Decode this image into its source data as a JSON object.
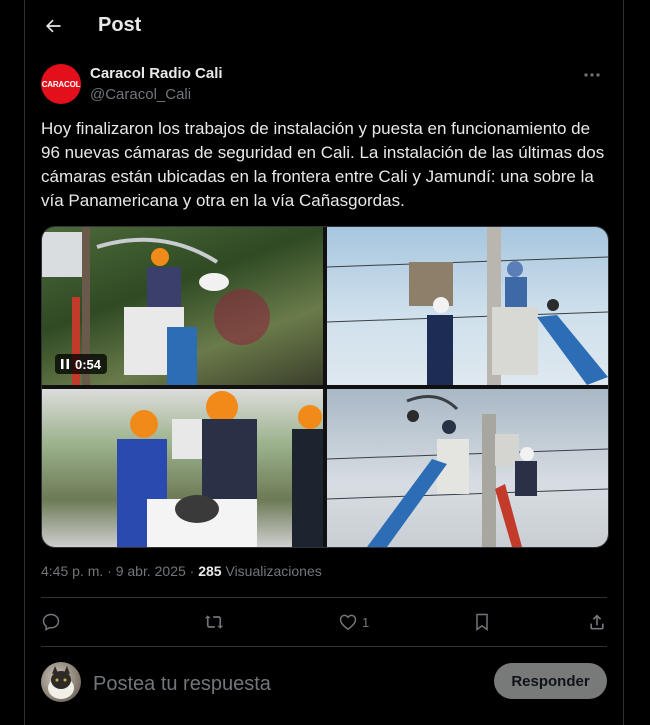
{
  "header": {
    "title": "Post",
    "back_icon": "arrow-left-icon"
  },
  "author": {
    "avatar_text": "CARACOL",
    "name": "Caracol Radio Cali",
    "handle": "@Caracol_Cali",
    "brand_color": "#e3101b",
    "more_icon": "more-dots-icon"
  },
  "post": {
    "text": "Hoy finalizaron los trabajos de instalación y puesta en funcionamiento de 96 nuevas cámaras de seguridad en Cali. La instalación de las últimas dos cámaras están ubicadas en la frontera entre Cali y Jamundí: una sobre la vía Panamericana y otra en la vía Cañasgordas.",
    "media": {
      "video_duration": "0:54",
      "tiles": [
        "video-worker-bucket",
        "photo-pole-camera",
        "photo-workers-camera",
        "photo-lift-pole"
      ]
    },
    "time": "4:45 p. m.",
    "date": "9 abr. 2025",
    "views_count": "285",
    "views_label": "Visualizaciones"
  },
  "actions": {
    "reply_icon": "reply-icon",
    "repost_icon": "repost-icon",
    "like_icon": "heart-icon",
    "like_count": "1",
    "bookmark_icon": "bookmark-icon",
    "share_icon": "share-icon"
  },
  "reply": {
    "placeholder": "Postea tu respuesta",
    "button_label": "Responder"
  },
  "colors": {
    "background": "#000000",
    "text": "#e7e9ea",
    "muted": "#71767b",
    "border": "#2f3336"
  }
}
